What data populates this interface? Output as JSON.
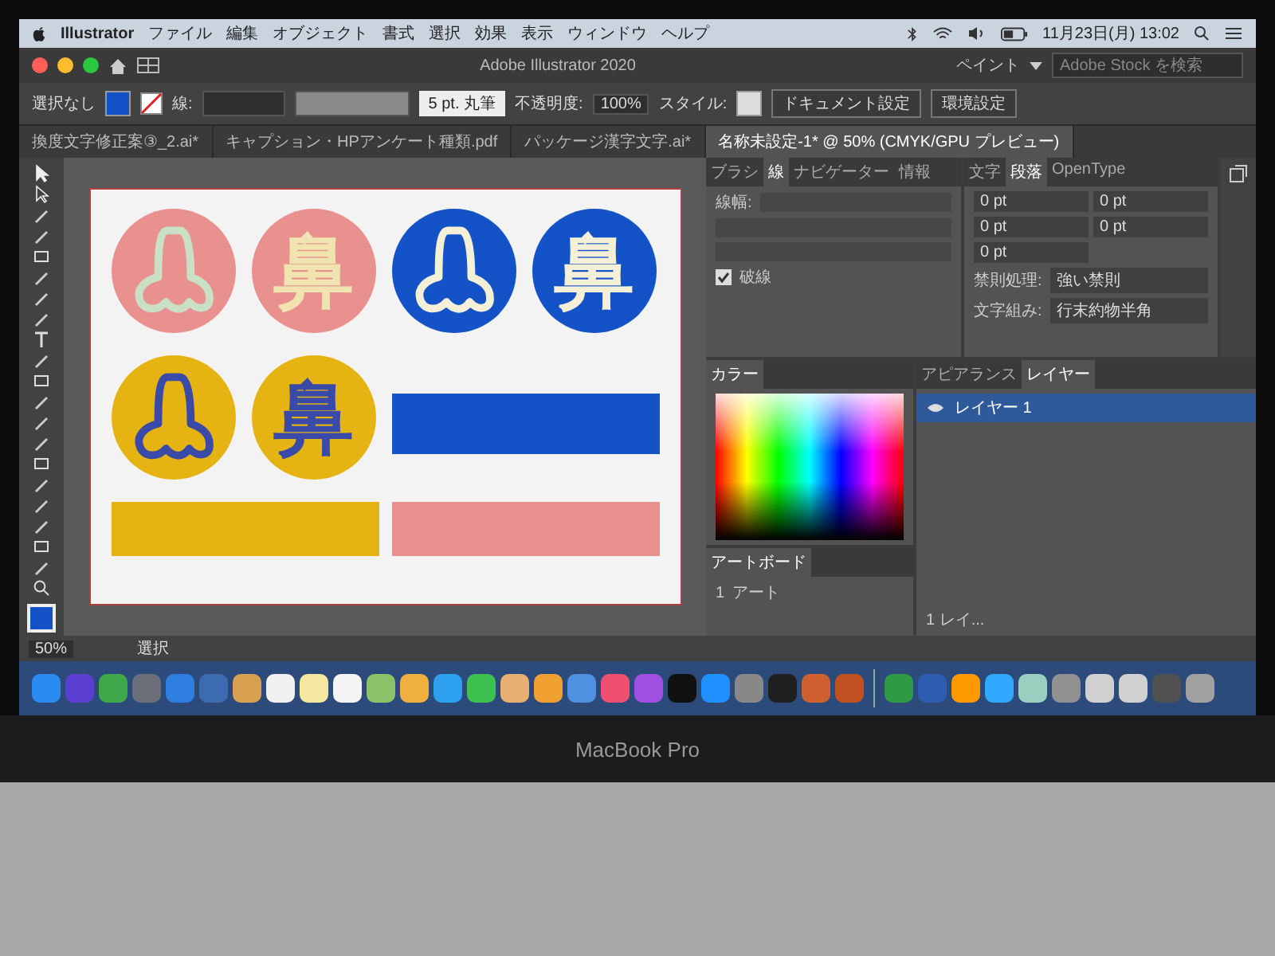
{
  "menu_bar": {
    "app": "Illustrator",
    "items": [
      "ファイル",
      "編集",
      "オブジェクト",
      "書式",
      "選択",
      "効果",
      "表示",
      "ウィンドウ",
      "ヘルプ"
    ],
    "clock": "11月23日(月) 13:02"
  },
  "title_bar": {
    "title": "Adobe Illustrator 2020",
    "workspace": "ペイント",
    "search": {
      "placeholder": "Adobe Stock を検索"
    }
  },
  "control_bar": {
    "selection": "選択なし",
    "stroke_label": "線:",
    "brush": "5 pt. 丸筆",
    "opacity_label": "不透明度:",
    "opacity": "100%",
    "style_label": "スタイル:",
    "buttons": [
      "ドキュメント設定",
      "環境設定"
    ]
  },
  "tabs": [
    {
      "label": "換度文字修正案③_2.ai*",
      "selected": false
    },
    {
      "label": "キャプション・HPアンケート種類.pdf",
      "selected": false
    },
    {
      "label": "パッケージ漢字文字.ai*",
      "selected": false
    },
    {
      "label": "名称未設定-1* @ 50% (CMYK/GPU プレビュー)",
      "selected": true
    }
  ],
  "artwork": {
    "circles": [
      {
        "kind": "nose",
        "color": "#e8918f",
        "figure": {
          "color": "#c9e0c4"
        }
      },
      {
        "kind": "kanji",
        "color": "#e8918f",
        "text": "鼻",
        "figure": {
          "color": "#efe3b0"
        }
      },
      {
        "kind": "nose",
        "color": "#1452c8",
        "figure": {
          "color": "#f4f0d8"
        }
      },
      {
        "kind": "kanji",
        "color": "#1452c8",
        "text": "鼻",
        "figure": {
          "color": "#f4f0d8"
        }
      },
      {
        "kind": "nose",
        "color": "#e6b412",
        "figure": {
          "color": "#3a4aa8"
        }
      },
      {
        "kind": "kanji",
        "color": "#e6b412",
        "text": "鼻",
        "figure": {
          "color": "#3a4aa8"
        }
      }
    ],
    "bars": [
      {
        "color": "#1452c8"
      },
      {
        "color": "#e6b412"
      },
      {
        "color": "#e8918f"
      }
    ]
  },
  "stroke_panel": {
    "tabs": [
      {
        "label": "ブラシ",
        "selected": false
      },
      {
        "label": "線",
        "selected": true
      },
      {
        "label": "ナビゲーター",
        "selected": false
      },
      {
        "label": "情報",
        "selected": false
      }
    ],
    "weight_label": "線幅:",
    "dash": {
      "label": "破線",
      "checked": true
    }
  },
  "paragraph_panel": {
    "tabs": [
      {
        "label": "文字",
        "selected": false
      },
      {
        "label": "段落",
        "selected": true
      },
      {
        "label": "OpenType",
        "selected": false
      }
    ],
    "indents": [
      "0 pt",
      "0 pt",
      "0 pt",
      "0 pt",
      "0 pt"
    ],
    "kinsoku_label": "禁則処理:",
    "kinsoku": "強い禁則",
    "mojikumi_label": "文字組み:",
    "mojikumi": "行末約物半角"
  },
  "color_panel": {
    "tabs": [
      {
        "label": "カラー",
        "selected": true
      }
    ]
  },
  "layers_panel": {
    "tabs": [
      {
        "label": "アピアランス",
        "selected": false
      },
      {
        "label": "レイヤー",
        "selected": true
      }
    ],
    "layers": [
      {
        "name": "レイヤー 1",
        "selected": true,
        "visible": true
      }
    ],
    "footer": "1 レイ..."
  },
  "artboards_panel": {
    "tabs": [
      {
        "label": "アートボード",
        "selected": true
      }
    ],
    "rows": [
      {
        "number": "1",
        "name": "アート"
      }
    ]
  },
  "status_bar": {
    "zoom": "50%",
    "tool": "選択"
  },
  "bezel": {
    "label": "MacBook Pro"
  }
}
